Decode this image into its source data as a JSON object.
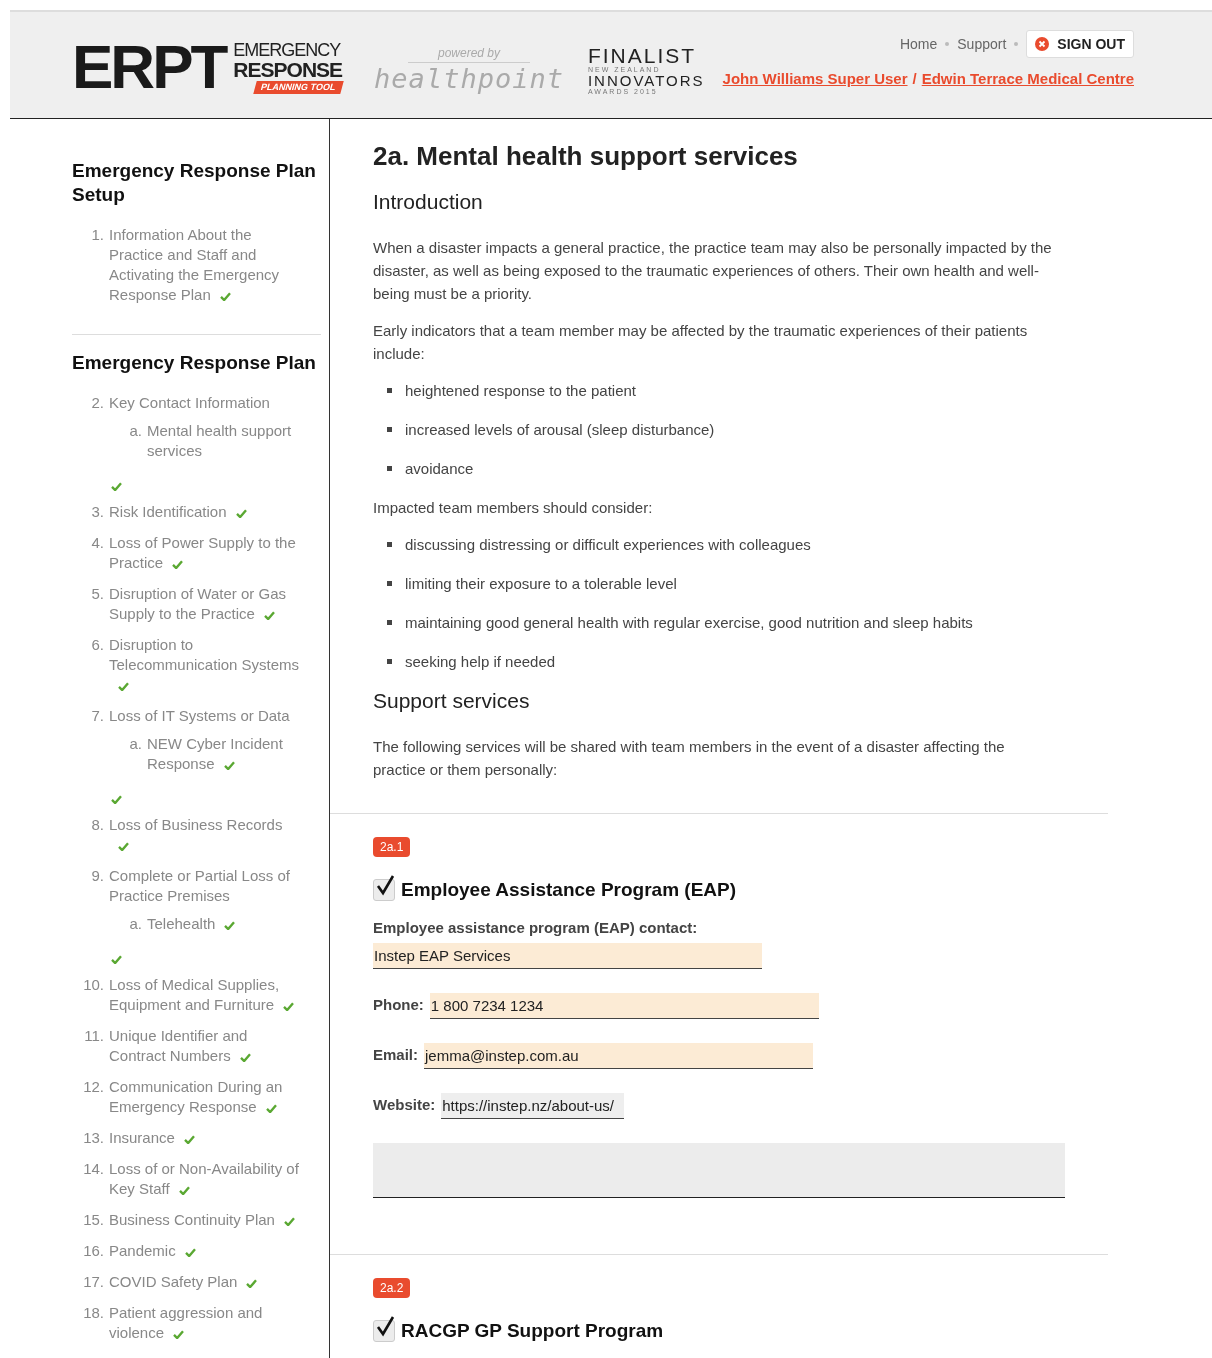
{
  "header": {
    "logo": {
      "letters": "ERPT",
      "line_1": "EMERGENCY",
      "line_2": "RESPONSE",
      "line_3": "PLANNING TOOL"
    },
    "powered_by": {
      "caption": "powered by",
      "brand": "healthpoint"
    },
    "award": {
      "line_1": "FINALIST",
      "line_2": "NEW ZEALAND",
      "line_3": "INNOVATORS",
      "line_4": "AWARDS 2015"
    },
    "nav_links": [
      "Home",
      "Support"
    ],
    "sign_out": "SIGN OUT",
    "user_link": "John Williams Super User",
    "separator": "/",
    "practice_link": "Edwin Terrace Medical Centre"
  },
  "sidebar": {
    "sections": [
      {
        "title": "Emergency Response Plan Setup",
        "items": [
          {
            "number": "1.",
            "label": "Information About the Practice and Staff and Activating the Emergency Response Plan",
            "done": true
          }
        ]
      },
      {
        "title": "Emergency Response Plan",
        "items": [
          {
            "number": "2.",
            "label": "Key Contact Information",
            "done": true,
            "children": [
              {
                "number": "a.",
                "label": "Mental health support services"
              }
            ]
          },
          {
            "number": "3.",
            "label": "Risk Identification",
            "done": true
          },
          {
            "number": "4.",
            "label": "Loss of Power Supply to the Practice",
            "done": true
          },
          {
            "number": "5.",
            "label": "Disruption of Water or Gas Supply to the Practice",
            "done": true
          },
          {
            "number": "6.",
            "label": "Disruption to Telecommunication Systems",
            "done": true
          },
          {
            "number": "7.",
            "label": "Loss of IT Systems or Data",
            "done": true,
            "children": [
              {
                "number": "a.",
                "label": "NEW Cyber Incident Response",
                "done": true
              }
            ]
          },
          {
            "number": "8.",
            "label": "Loss of Business Records",
            "done": true
          },
          {
            "number": "9.",
            "label": "Complete or Partial Loss of Practice Premises",
            "done": true,
            "children": [
              {
                "number": "a.",
                "label": "Telehealth",
                "done": true
              }
            ]
          },
          {
            "number": "10.",
            "label": "Loss of Medical Supplies, Equipment and Furniture",
            "done": true
          },
          {
            "number": "11.",
            "label": "Unique Identifier and Contract Numbers",
            "done": true
          },
          {
            "number": "12.",
            "label": "Communication During an Emergency Response",
            "done": true
          },
          {
            "number": "13.",
            "label": "Insurance",
            "done": true
          },
          {
            "number": "14.",
            "label": "Loss of or Non-Availability of Key Staff",
            "done": true
          },
          {
            "number": "15.",
            "label": "Business Continuity Plan",
            "done": true
          },
          {
            "number": "16.",
            "label": "Pandemic",
            "done": true
          },
          {
            "number": "17.",
            "label": "COVID Safety Plan",
            "done": true
          },
          {
            "number": "18.",
            "label": "Patient aggression and violence",
            "done": true
          }
        ]
      }
    ]
  },
  "main": {
    "title": "2a. Mental health support services",
    "blocks": [
      {
        "kind": "heading",
        "text": "Introduction"
      },
      {
        "kind": "paragraph",
        "text": "When a disaster impacts a general practice, the practice team may also be personally impacted by the disaster, as well as being exposed to the traumatic experiences of others. Their own health and well-being must be a priority."
      },
      {
        "kind": "paragraph",
        "text": "Early indicators that a team member may be affected by the traumatic experiences of their patients include:"
      },
      {
        "kind": "bullets",
        "items": [
          "heightened response to the patient",
          "increased levels of arousal (sleep disturbance)",
          "avoidance"
        ]
      },
      {
        "kind": "paragraph",
        "text": "Impacted team members should consider:"
      },
      {
        "kind": "bullets",
        "items": [
          "discussing distressing or difficult experiences with colleagues",
          "limiting their exposure to a tolerable level",
          "maintaining good general health with regular exercise, good nutrition and sleep habits",
          "seeking help if needed"
        ]
      },
      {
        "kind": "heading",
        "text": "Support services"
      },
      {
        "kind": "paragraph",
        "text": "The following services will be shared with team members in the event of a disaster affecting the practice or them personally:"
      }
    ],
    "sections": [
      {
        "number": "2a.1",
        "checked": true,
        "title": "Employee Assistance Program (EAP)",
        "fields": [
          {
            "kind": "stacked",
            "label": "Employee assistance program (EAP) contact:",
            "value": "Instep EAP Services"
          },
          {
            "kind": "inline",
            "label": "Phone:",
            "value": "1 800 7234 1234"
          },
          {
            "kind": "inline",
            "label": "Email:",
            "value": "jemma@instep.com.au"
          },
          {
            "kind": "link",
            "label": "Website:",
            "value": "https://instep.nz/about-us/"
          },
          {
            "kind": "notes"
          }
        ]
      },
      {
        "number": "2a.2",
        "checked": true,
        "title": "RACGP GP Support Program"
      }
    ]
  }
}
